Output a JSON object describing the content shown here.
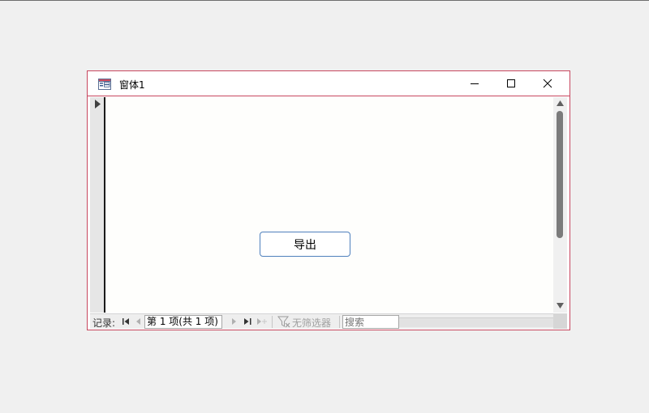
{
  "window": {
    "title": "窗体1"
  },
  "form": {
    "export_button_label": "导出"
  },
  "navigation": {
    "record_label": "记录:",
    "record_position": "第 1 项(共 1 项)",
    "filter_label": "无筛选器",
    "search_placeholder": "搜索"
  },
  "icons": {
    "app": "form-icon",
    "minimize": "minimize-icon",
    "maximize": "maximize-icon",
    "close": "close-icon",
    "record_selector": "current-record-arrow-icon",
    "first": "first-record-icon",
    "prev": "previous-record-icon",
    "next": "next-record-icon",
    "last": "last-record-icon",
    "new": "new-record-icon",
    "filter": "no-filter-icon"
  },
  "colors": {
    "window_border": "#c8475f",
    "button_border": "#4f80bd",
    "scroll_thumb": "#7b7b7b"
  }
}
